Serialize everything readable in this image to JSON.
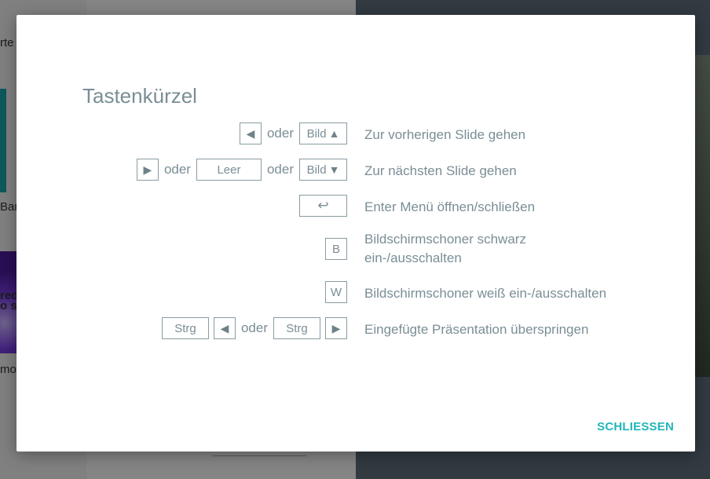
{
  "modal": {
    "title": "Tastenkürzel",
    "close_label": "SCHLIESSEN"
  },
  "shortcuts": [
    {
      "keys": [
        "◀",
        "oder",
        "Bild ▲"
      ],
      "description": "Zur vorherigen Slide gehen"
    },
    {
      "keys": [
        "▶",
        "oder",
        "Leer",
        "oder",
        "Bild ▼"
      ],
      "description": "Zur nächsten Slide gehen"
    },
    {
      "keys": [
        "↩"
      ],
      "description": "Enter Menü öffnen/schließen"
    },
    {
      "keys": [
        "B"
      ],
      "description_line1": "Bildschirmschoner schwarz",
      "description_line2": "ein-/ausschalten"
    },
    {
      "keys": [
        "W"
      ],
      "description": "Bildschirmschoner weiß ein-/ausschalten"
    },
    {
      "keys": [
        "Strg",
        "◀",
        "oder",
        "Strg",
        "▶"
      ],
      "description": "Eingefügte Präsentation überspringen"
    }
  ],
  "labels": {
    "or": "oder",
    "bild": "Bild",
    "leer": "Leer",
    "strg": "Strg",
    "b": "B",
    "w": "W"
  },
  "background": {
    "left_texts": [
      "rte",
      "Bar",
      "red",
      "o s",
      "mo"
    ]
  },
  "colors": {
    "accent": "#20b6b8",
    "text": "#7a8e95"
  }
}
